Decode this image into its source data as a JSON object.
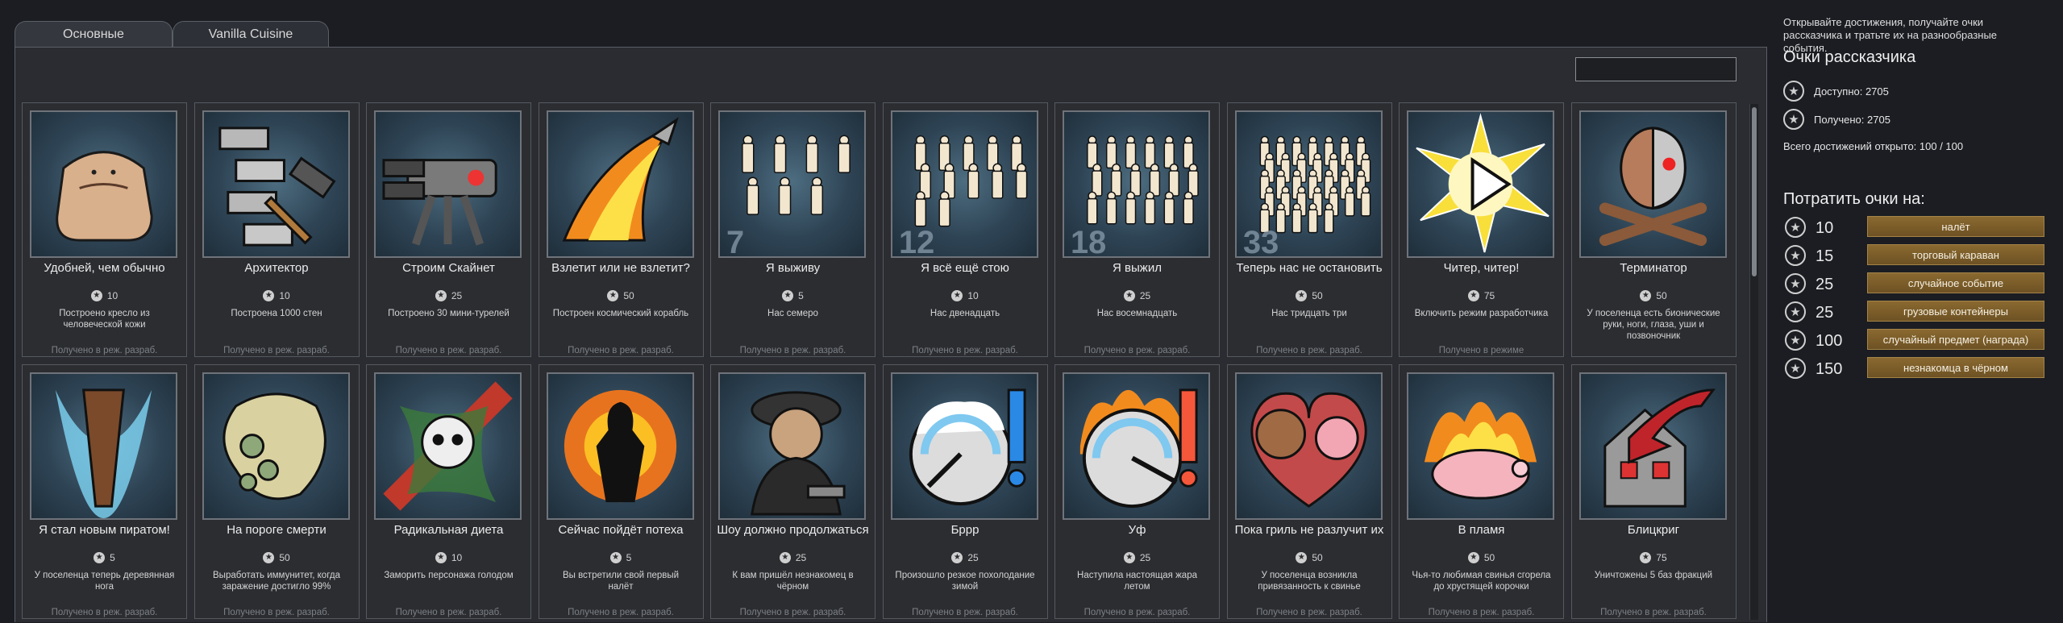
{
  "tabs": [
    {
      "label": "Основные",
      "active": true
    },
    {
      "label": "Vanilla Cuisine",
      "active": false
    }
  ],
  "search": {
    "value": "",
    "placeholder": ""
  },
  "achievements": [
    {
      "title": "Удобней, чем обычно",
      "points": "10",
      "desc": "Построено кресло из человеческой кожи",
      "status": "Получено в реж. разраб.",
      "icon": "armchair-icon"
    },
    {
      "title": "Архитектор",
      "points": "10",
      "desc": "Построена 1000 стен",
      "status": "Получено в реж. разраб.",
      "icon": "wall-hammer-icon"
    },
    {
      "title": "Строим Скайнет",
      "points": "25",
      "desc": "Построено 30 мини-турелей",
      "status": "Получено в реж. разраб.",
      "icon": "turret-icon"
    },
    {
      "title": "Взлетит или не взлетит?",
      "points": "50",
      "desc": "Построен космический корабль",
      "status": "Получено в реж. разраб.",
      "icon": "rocket-launch-icon"
    },
    {
      "title": "Я выживу",
      "points": "5",
      "desc": "Нас семеро",
      "status": "Получено в реж. разраб.",
      "icon": "colonists-7-icon",
      "badge": "7"
    },
    {
      "title": "Я всё ещё стою",
      "points": "10",
      "desc": "Нас двенадцать",
      "status": "Получено в реж. разраб.",
      "icon": "colonists-12-icon",
      "badge": "12"
    },
    {
      "title": "Я выжил",
      "points": "25",
      "desc": "Нас восемнадцать",
      "status": "Получено в реж. разраб.",
      "icon": "colonists-18-icon",
      "badge": "18"
    },
    {
      "title": "Теперь нас не остановить",
      "points": "50",
      "desc": "Нас тридцать три",
      "status": "Получено в реж. разраб.",
      "icon": "colonists-33-icon",
      "badge": "33"
    },
    {
      "title": "Читер, читер!",
      "points": "75",
      "desc": "Включить режим разработчика",
      "status": "Получено в режиме",
      "icon": "dev-mode-burst-icon"
    },
    {
      "title": "Терминатор",
      "points": "50",
      "desc": "У поселенца есть бионические руки, ноги, глаза, уши и позвоночник",
      "status": "",
      "icon": "cyborg-icon"
    },
    {
      "title": "Я стал новым пиратом!",
      "points": "5",
      "desc": "У поселенца теперь деревянная нога",
      "status": "Получено в реж. разраб.",
      "icon": "peg-leg-icon"
    },
    {
      "title": "На пороге смерти",
      "points": "50",
      "desc": "Выработать иммунитет, когда заражение достигло 99%",
      "status": "Получено в реж. разраб.",
      "icon": "plague-icon"
    },
    {
      "title": "Радикальная диета",
      "points": "10",
      "desc": "Заморить персонажа голодом",
      "status": "Получено в реж. разраб.",
      "icon": "skull-icon"
    },
    {
      "title": "Сейчас пойдёт потеха",
      "points": "5",
      "desc": "Вы встретили свой первый налёт",
      "status": "Получено в реж. разраб.",
      "icon": "raid-explosion-icon"
    },
    {
      "title": "Шоу должно продолжаться",
      "points": "25",
      "desc": "К вам пришёл незнакомец в чёрном",
      "status": "Получено в реж. разраб.",
      "icon": "stranger-icon"
    },
    {
      "title": "Бррр",
      "points": "25",
      "desc": "Произошло резкое похолодание зимой",
      "status": "Получено в реж. разраб.",
      "icon": "cold-gauge-icon"
    },
    {
      "title": "Уф",
      "points": "25",
      "desc": "Наступила настоящая жара летом",
      "status": "Получено в реж. разраб.",
      "icon": "heat-gauge-icon"
    },
    {
      "title": "Пока гриль не разлучит их",
      "points": "50",
      "desc": "У поселенца возникла привязанность к свинье",
      "status": "Получено в реж. разраб.",
      "icon": "pig-heart-icon"
    },
    {
      "title": "В пламя",
      "points": "50",
      "desc": "Чья-то любимая свинья сгорела до хрустящей корочки",
      "status": "Получено в реж. разраб.",
      "icon": "burning-pig-icon"
    },
    {
      "title": "Блицкриг",
      "points": "75",
      "desc": "Уничтожены 5 баз фракций",
      "status": "Получено в реж. разраб.",
      "icon": "destroyed-base-icon"
    }
  ],
  "sidebar": {
    "intro": "Открывайте достижения, получайте очки рассказчика и тратьте их на разнообразные события.",
    "heading": "Очки рассказчика",
    "available": "Доступно: 2705",
    "earned": "Получено: 2705",
    "total": "Всего достижений открыто: 100 / 100",
    "spend_heading": "Потратить очки на:",
    "spend": [
      {
        "cost": "10",
        "label": "налёт"
      },
      {
        "cost": "15",
        "label": "торговый караван"
      },
      {
        "cost": "25",
        "label": "случайное событие"
      },
      {
        "cost": "25",
        "label": "грузовые контейнеры"
      },
      {
        "cost": "100",
        "label": "случайный предмет (награда)"
      },
      {
        "cost": "150",
        "label": "незнакомца в чёрном"
      }
    ]
  }
}
